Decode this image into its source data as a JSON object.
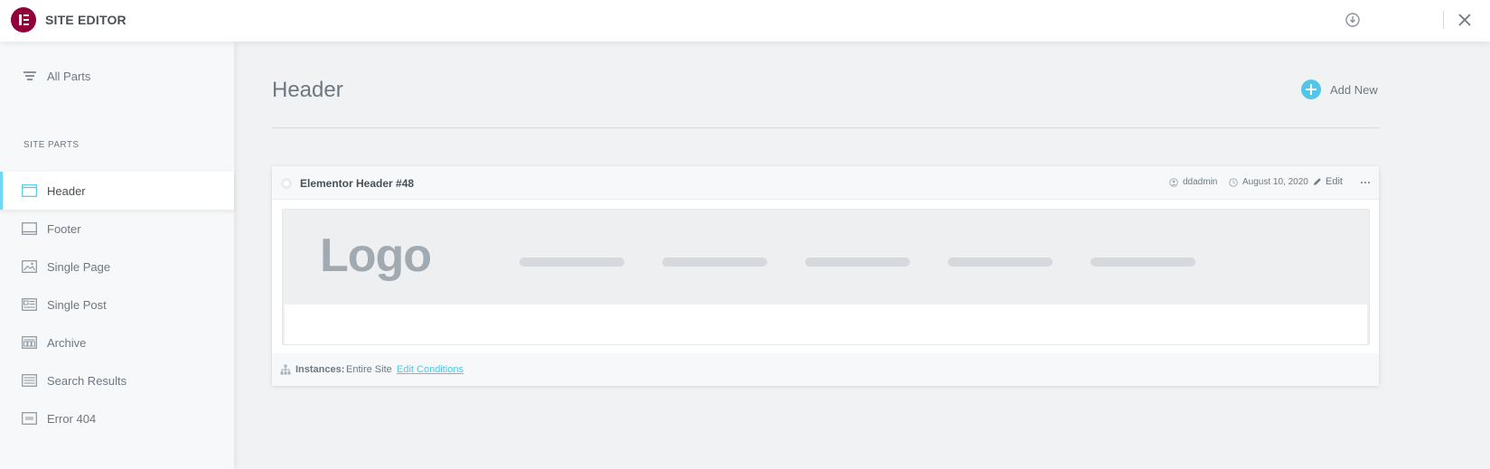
{
  "app": {
    "title": "SITE EDITOR",
    "brand_color": "#92003b",
    "accent_color": "#52c6e8"
  },
  "topbar": {
    "icons": [
      "download-icon",
      "close-icon"
    ]
  },
  "sidebar": {
    "all_parts_label": "All Parts",
    "section_title": "SITE PARTS",
    "items": [
      {
        "label": "Header",
        "icon": "header-icon",
        "active": true
      },
      {
        "label": "Footer",
        "icon": "footer-icon",
        "active": false
      },
      {
        "label": "Single Page",
        "icon": "single-page-icon",
        "active": false
      },
      {
        "label": "Single Post",
        "icon": "single-post-icon",
        "active": false
      },
      {
        "label": "Archive",
        "icon": "archive-icon",
        "active": false
      },
      {
        "label": "Search Results",
        "icon": "search-results-icon",
        "active": false
      },
      {
        "label": "Error 404",
        "icon": "error-404-icon",
        "active": false
      }
    ]
  },
  "main": {
    "title": "Header",
    "add_new_label": "Add New"
  },
  "card": {
    "title": "Elementor Header #48",
    "author": "ddadmin",
    "date": "August 10, 2020",
    "edit_label": "Edit",
    "preview_logo": "Logo",
    "instances_label": "Instances:",
    "instances_value": "Entire Site",
    "edit_conditions_label": "Edit Conditions"
  }
}
